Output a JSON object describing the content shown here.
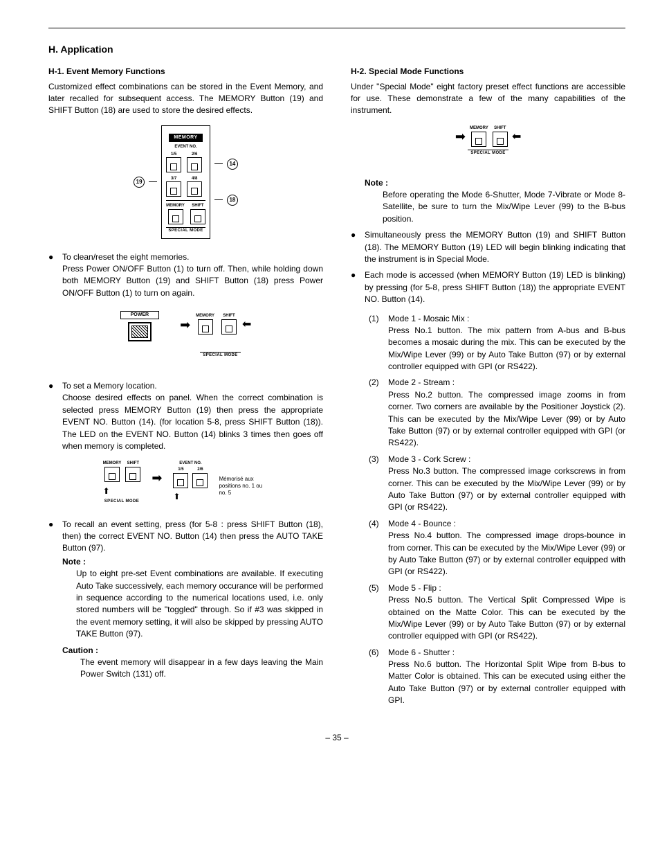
{
  "page_number": "– 35 –",
  "heading": "H. Application",
  "left": {
    "h1_title": "H-1. Event Memory Functions",
    "intro": "Customized effect combinations can be stored in the Event Memory, and later recalled for subsequent access. The MEMORY Button (19) and SHIFT Button (18) are used to store the desired effects.",
    "diag1": {
      "memory": "MEMORY",
      "event_no": "EVENT NO.",
      "k15": "1/5",
      "k26": "2/6",
      "k37": "3/7",
      "k48": "4/8",
      "shift": "SHIFT",
      "special": "SPECIAL  MODE",
      "c14": "14",
      "c18": "18",
      "c19": "19"
    },
    "bullet1": "To clean/reset the eight memories.",
    "bullet1b": "Press Power ON/OFF Button (1) to turn off. Then, while holding down both MEMORY Button (19) and SHIFT Button (18) press Power ON/OFF Button (1) to turn on again.",
    "diag2": {
      "power": "POWER",
      "memory": "MEMORY",
      "shift": "SHIFT",
      "special": "SPECIAL  MODE"
    },
    "bullet2": "To set a Memory location.",
    "bullet2b": "Choose desired effects on panel. When the correct combination is selected press MEMORY Button (19) then press the appropriate EVENT NO. Button (14). (for location 5-8, press SHIFT Button (18)). The LED on the EVENT NO. Button (14) blinks 3 times then goes off when memory is completed.",
    "diag3": {
      "memory": "MEMORY",
      "shift": "SHIFT",
      "special": "SPECIAL  MODE",
      "event_no": "EVENT NO.",
      "k15": "1/5",
      "k26": "2/6",
      "memo": "Mémorisé aux positions no. 1 ou no. 5"
    },
    "bullet3": "To recall an event setting, press (for 5-8 : press SHIFT Button (18), then) the correct EVENT NO. Button (14) then press the AUTO TAKE Button (97).",
    "note_label": "Note :",
    "note_body": "Up to eight pre-set Event combinations are available. If executing Auto Take successively, each memory occurance will be performed in sequence according to the numerical locations used, i.e. only stored numbers will be \"toggled\" through. So if #3 was skipped in the event memory setting, it will also be skipped by pressing AUTO TAKE Button (97).",
    "caution_label": "Caution :",
    "caution_body": "The event memory will disappear in a few days leaving the Main Power Switch (131) off."
  },
  "right": {
    "h2_title": "H-2. Special Mode Functions",
    "intro": "Under \"Special Mode\" eight factory preset effect functions are accessible for use. These demonstrate a few of the many capabilities of the instrument.",
    "diag": {
      "memory": "MEMORY",
      "shift": "SHIFT",
      "special": "SPECIAL  MODE"
    },
    "note_label": "Note :",
    "note_body": "Before operating the Mode 6-Shutter, Mode 7-Vibrate or Mode 8-Satellite, be sure to turn the Mix/Wipe Lever (99) to the B-bus position.",
    "bullet1": "Simultaneously press the MEMORY Button (19) and SHIFT Button (18). The MEMORY Button (19) LED will begin blinking indicating that the instrument is in Special Mode.",
    "bullet2": "Each mode is accessed (when MEMORY Button (19) LED is blinking) by pressing (for 5-8, press SHIFT Button (18)) the appropriate EVENT NO. Button (14).",
    "modes": [
      {
        "n": "(1)",
        "t": "Mode 1 - Mosaic Mix :",
        "b": "Press No.1 button. The mix pattern from A-bus and B-bus becomes a mosaic during the mix. This can be executed by the Mix/Wipe Lever (99) or by Auto Take Button (97) or by external controller equipped with GPI (or RS422)."
      },
      {
        "n": "(2)",
        "t": "Mode 2 - Stream :",
        "b": "Press No.2 button. The compressed image zooms in from corner. Two corners are available by the Positioner Joystick (2). This can be executed by the Mix/Wipe Lever (99) or by Auto Take Button (97) or by external controller equipped with GPI (or RS422)."
      },
      {
        "n": "(3)",
        "t": "Mode 3 - Cork Screw :",
        "b": "Press No.3 button. The compressed image corkscrews in from corner. This can be executed by the Mix/Wipe Lever (99) or by Auto Take Button (97) or by external controller equipped with GPI (or RS422)."
      },
      {
        "n": "(4)",
        "t": "Mode 4 - Bounce :",
        "b": "Press No.4 button. The compressed image drops-bounce in from corner. This can be executed by the Mix/Wipe Lever (99) or by Auto Take Button (97) or by external controller equipped with GPI (or RS422)."
      },
      {
        "n": "(5)",
        "t": "Mode 5 - Flip :",
        "b": "Press No.5 button. The Vertical Split Compressed Wipe is obtained on the Matte Color. This can be executed by the Mix/Wipe Lever (99) or by Auto Take Button (97) or by external controller equipped with GPI (or RS422)."
      },
      {
        "n": "(6)",
        "t": "Mode 6 - Shutter :",
        "b": "Press No.6 button. The Horizontal Split Wipe from B-bus to Matter Color is obtained. This can be executed using either the Auto Take Button (97) or by external controller equipped with GPI."
      }
    ]
  }
}
